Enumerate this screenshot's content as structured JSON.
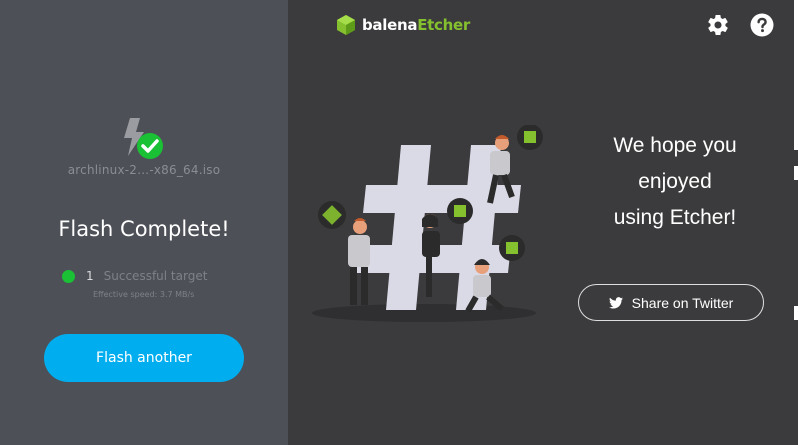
{
  "app": {
    "logo_text_1": "balena",
    "logo_text_2": "Etcher",
    "brand_green": "#85c12e",
    "accent": "#00aeef"
  },
  "header": {
    "settings_icon": "gear-icon",
    "help_icon": "help-icon"
  },
  "left_panel": {
    "filename": "archlinux-2…-x86_64.iso",
    "title": "Flash Complete!",
    "result_count": "1",
    "result_label": "Successful target",
    "speed": "Effective speed: 3.7 MB/s",
    "flash_another_label": "Flash another",
    "status_color": "#1ac135"
  },
  "right_panel": {
    "thanks_line1": "We hope you",
    "thanks_line2": "enjoyed",
    "thanks_line3": "using Etcher!",
    "share_label": "Share on Twitter",
    "share_icon": "twitter-icon"
  }
}
